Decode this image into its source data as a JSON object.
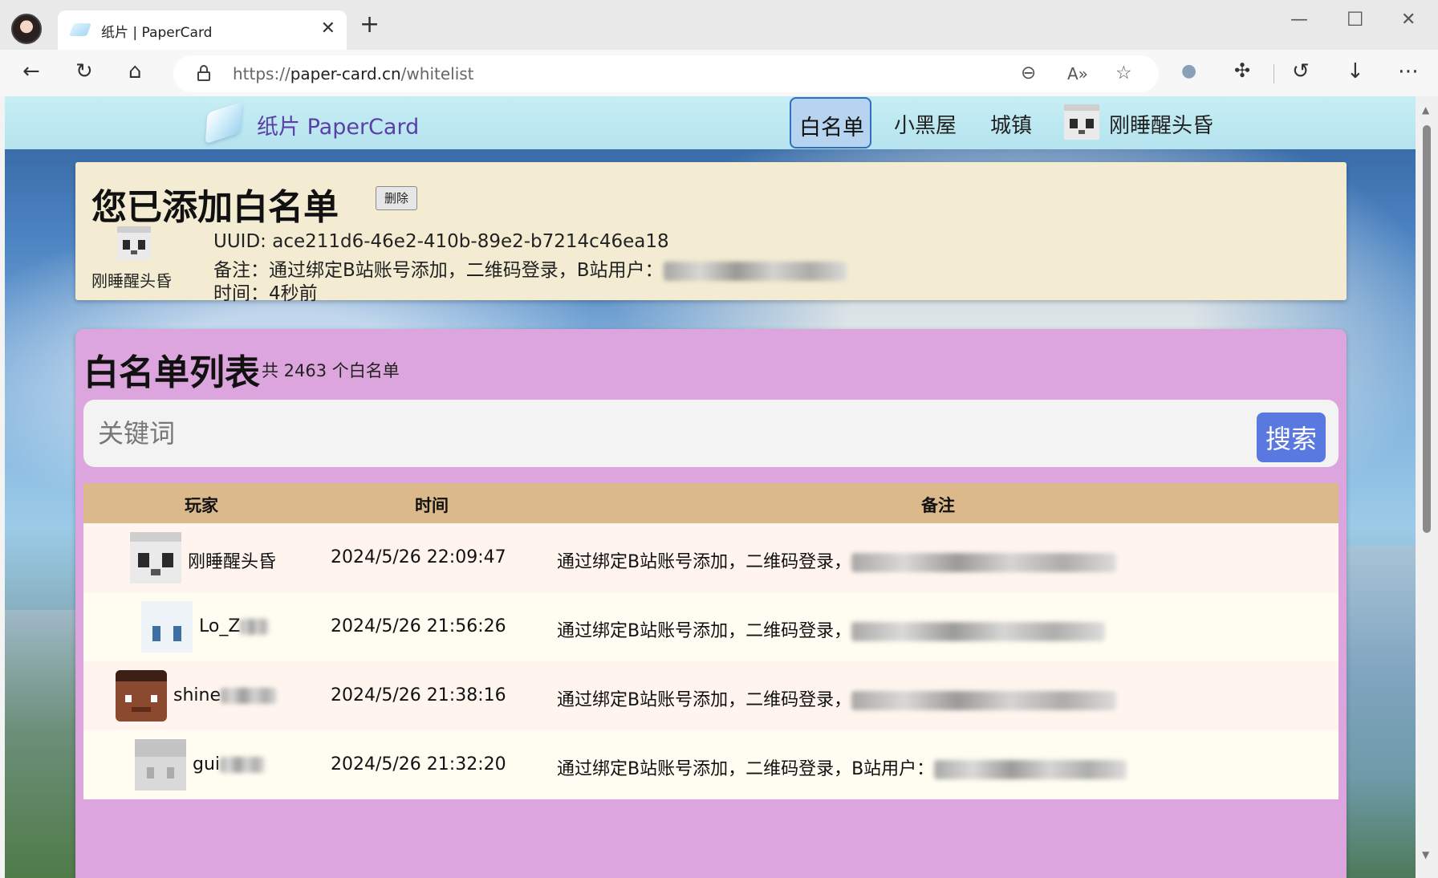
{
  "browser": {
    "tab_title": "纸片 | PaperCard",
    "url_prefix": "https://",
    "url_host": "paper-card.cn",
    "url_path": "/whitelist",
    "new_tab_glyph": "+",
    "icons": [
      "back-icon",
      "refresh-icon",
      "home-icon",
      "lock-icon",
      "zoom-out-icon",
      "read-aloud-icon",
      "favorite-icon",
      "extension-icon",
      "history-icon",
      "download-icon",
      "more-icon"
    ]
  },
  "site": {
    "name": "纸片 PaperCard",
    "nav": {
      "whitelist": "白名单",
      "blackroom": "小黑屋",
      "towns": "城镇",
      "user": "刚睡醒头昏"
    }
  },
  "added": {
    "title": "您已添加白名单",
    "delete_label": "删除",
    "player_name": "刚睡醒头昏",
    "uuid_line": "UUID: ace211d6-46e2-410b-89e2-b7214c46ea18",
    "note_line": "备注：通过绑定B站账号添加，二维码登录，B站用户：",
    "time_line": "时间：4秒前"
  },
  "list": {
    "title": "白名单列表",
    "count_text": "共 2463 个白名单",
    "search_placeholder": "关键词",
    "search_label": "搜索",
    "headers": {
      "player": "玩家",
      "time": "时间",
      "note": "备注"
    },
    "rows": [
      {
        "name": "刚睡醒头昏",
        "time": "2024/5/26 22:09:47",
        "note": "通过绑定B站账号添加，二维码登录，",
        "skin": "panda"
      },
      {
        "name": "Lo_Z",
        "time": "2024/5/26 21:56:26",
        "note": "通过绑定B站账号添加，二维码登录，",
        "skin": "white"
      },
      {
        "name": "shine",
        "time": "2024/5/26 21:38:16",
        "note": "通过绑定B站账号添加，二维码登录，",
        "skin": "brown"
      },
      {
        "name": "gui",
        "time": "2024/5/26 21:32:20",
        "note": "通过绑定B站账号添加，二维码登录，B站用户：",
        "skin": "grey"
      }
    ]
  },
  "colors": {
    "nav_bg": "#b5e3ee",
    "nav_active_bg": "#b6d3ef",
    "added_card_bg": "#f3ecd2",
    "list_card_bg": "#dca5dd",
    "table_header_bg": "#dcb98b",
    "search_button_bg": "#5a79e0",
    "site_name_color": "#5a3fa8"
  }
}
